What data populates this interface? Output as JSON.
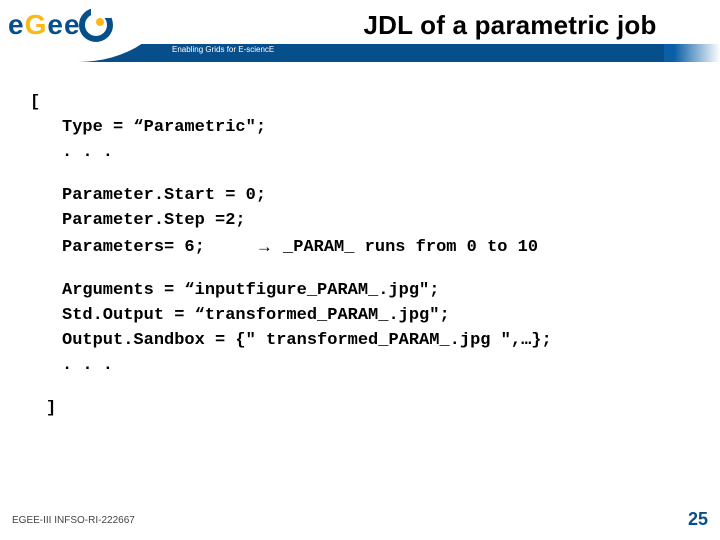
{
  "header": {
    "title": "JDL of a parametric job",
    "tagline": "Enabling Grids for E-sciencE",
    "logo": {
      "letters": [
        "e",
        "G",
        "e",
        "e"
      ]
    }
  },
  "code": {
    "open_bracket": "[",
    "close_bracket": "]",
    "type_line": "Type = “Parametric\";",
    "ellipsis1": ". . .",
    "param_start": "Parameter.Start = 0;",
    "param_step": "Parameter.Step =2;",
    "param_count_left": "Parameters= 6;",
    "arrow": "→",
    "param_count_right": " _PARAM_ runs from 0 to 10",
    "arguments": "Arguments = “inputfigure_PARAM_.jpg\";",
    "stdoutput": "Std.Output = “transformed_PARAM_.jpg\";",
    "outsandbox": "Output.Sandbox  = {\" transformed_PARAM_.jpg \",…};",
    "ellipsis2": ". . ."
  },
  "footer": {
    "left": "EGEE-III INFSO-RI-222667",
    "right": "25"
  }
}
